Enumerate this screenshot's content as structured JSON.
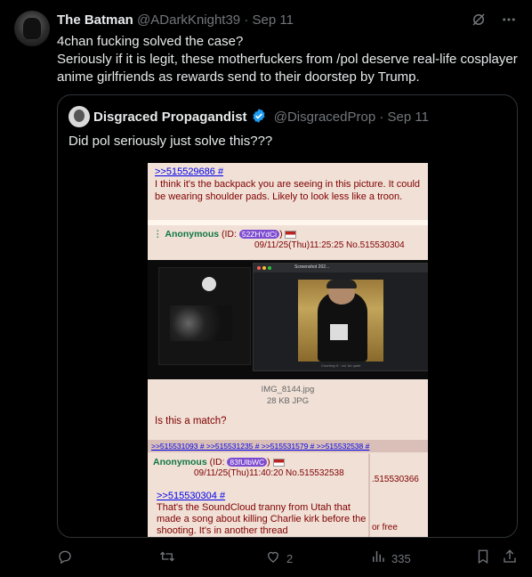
{
  "tweet": {
    "display_name": "The Batman",
    "handle": "@ADarkKnight39",
    "separator": "·",
    "date": "Sep 11",
    "text_line1": "4chan fucking solved the case?",
    "text_line2": "Seriously if it is legit, these motherfuckers from /pol deserve real-life cosplayer anime girlfriends as rewards send to their doorstep by Trump."
  },
  "quote": {
    "display_name": "Disgraced Propagandist",
    "handle": "@DisgracedProp",
    "separator": "·",
    "date": "Sep 11",
    "text": "Did pol seriously just solve this???"
  },
  "chan_image": {
    "post1_ref": ">>515529686 #",
    "post1_body": "I think it's the backpack you are seeing in this picture. It could be wearing shoulder pads. Likely to look less like a troon.",
    "post2_prefix": "⋮ ",
    "post2_name": "Anonymous",
    "post2_id_label": " (ID: ",
    "post2_id": "52ZHYdCi",
    "post2_id_close": ") ",
    "post2_datetime": "09/11/25(Thu)11:25:25 No.515530304",
    "screenshot_title": "Screenshot 202...",
    "screenshot_caption": "Courtesy it · vol. be quiet",
    "file_name": "IMG_8144.jpg",
    "file_size": "28 KB JPG",
    "question": "Is this a match?",
    "reply_links": ">>515531093 # >>515531235 # >>515531579 # >>515532538 #",
    "post3_name": "Anonymous",
    "post3_id_label": " (ID: ",
    "post3_id": "83fUlbWC",
    "post3_id_close": ") ",
    "post3_datetime": "09/11/25(Thu)11:40:20 No.515532538",
    "post3_ref": ">>515530304 #",
    "post3_body": "That's the SoundCloud tranny from Utah that made a song about killing Charlie kirk before the shooting. It's in another thread",
    "behind_text1": ".515530366",
    "behind_text2": "or free"
  },
  "actions": {
    "likes": "2",
    "views": "335"
  },
  "icons": {
    "grok": "grok-icon",
    "more": "more-icon",
    "reply": "reply-icon",
    "retweet": "retweet-icon",
    "like": "heart-icon",
    "views": "views-icon",
    "bookmark": "bookmark-icon",
    "share": "share-icon",
    "verified": "verified-badge-icon"
  },
  "colors": {
    "background": "#000000",
    "text": "#e7e9ea",
    "muted": "#71767b",
    "verified": "#1d9bf0",
    "border": "#2f3336"
  }
}
